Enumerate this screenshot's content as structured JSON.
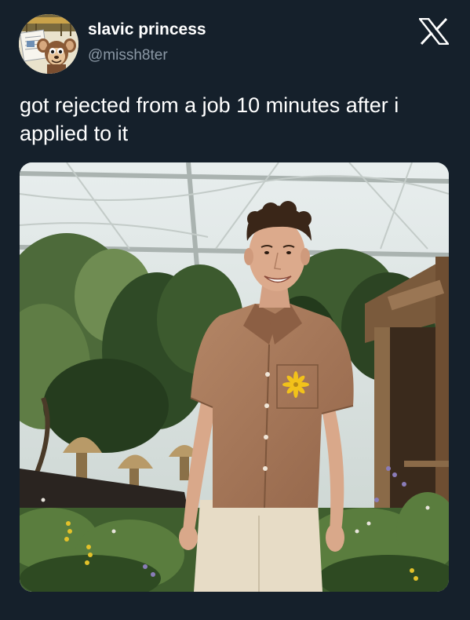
{
  "tweet": {
    "display_name": "slavic princess",
    "handle": "@missh8ter",
    "text": "got rejected from a job 10 minutes after i applied to it"
  },
  "icons": {
    "brand": "x-logo-icon",
    "avatar": "cartoon-character-avatar"
  },
  "media": {
    "subject": "photo-man-in-brown-shirt-in-garden"
  },
  "colors": {
    "background": "#15202b",
    "primary_text": "#ffffff",
    "secondary_text": "#8b98a5",
    "shirt": "#a8795a",
    "flower": "#f2c21a"
  }
}
